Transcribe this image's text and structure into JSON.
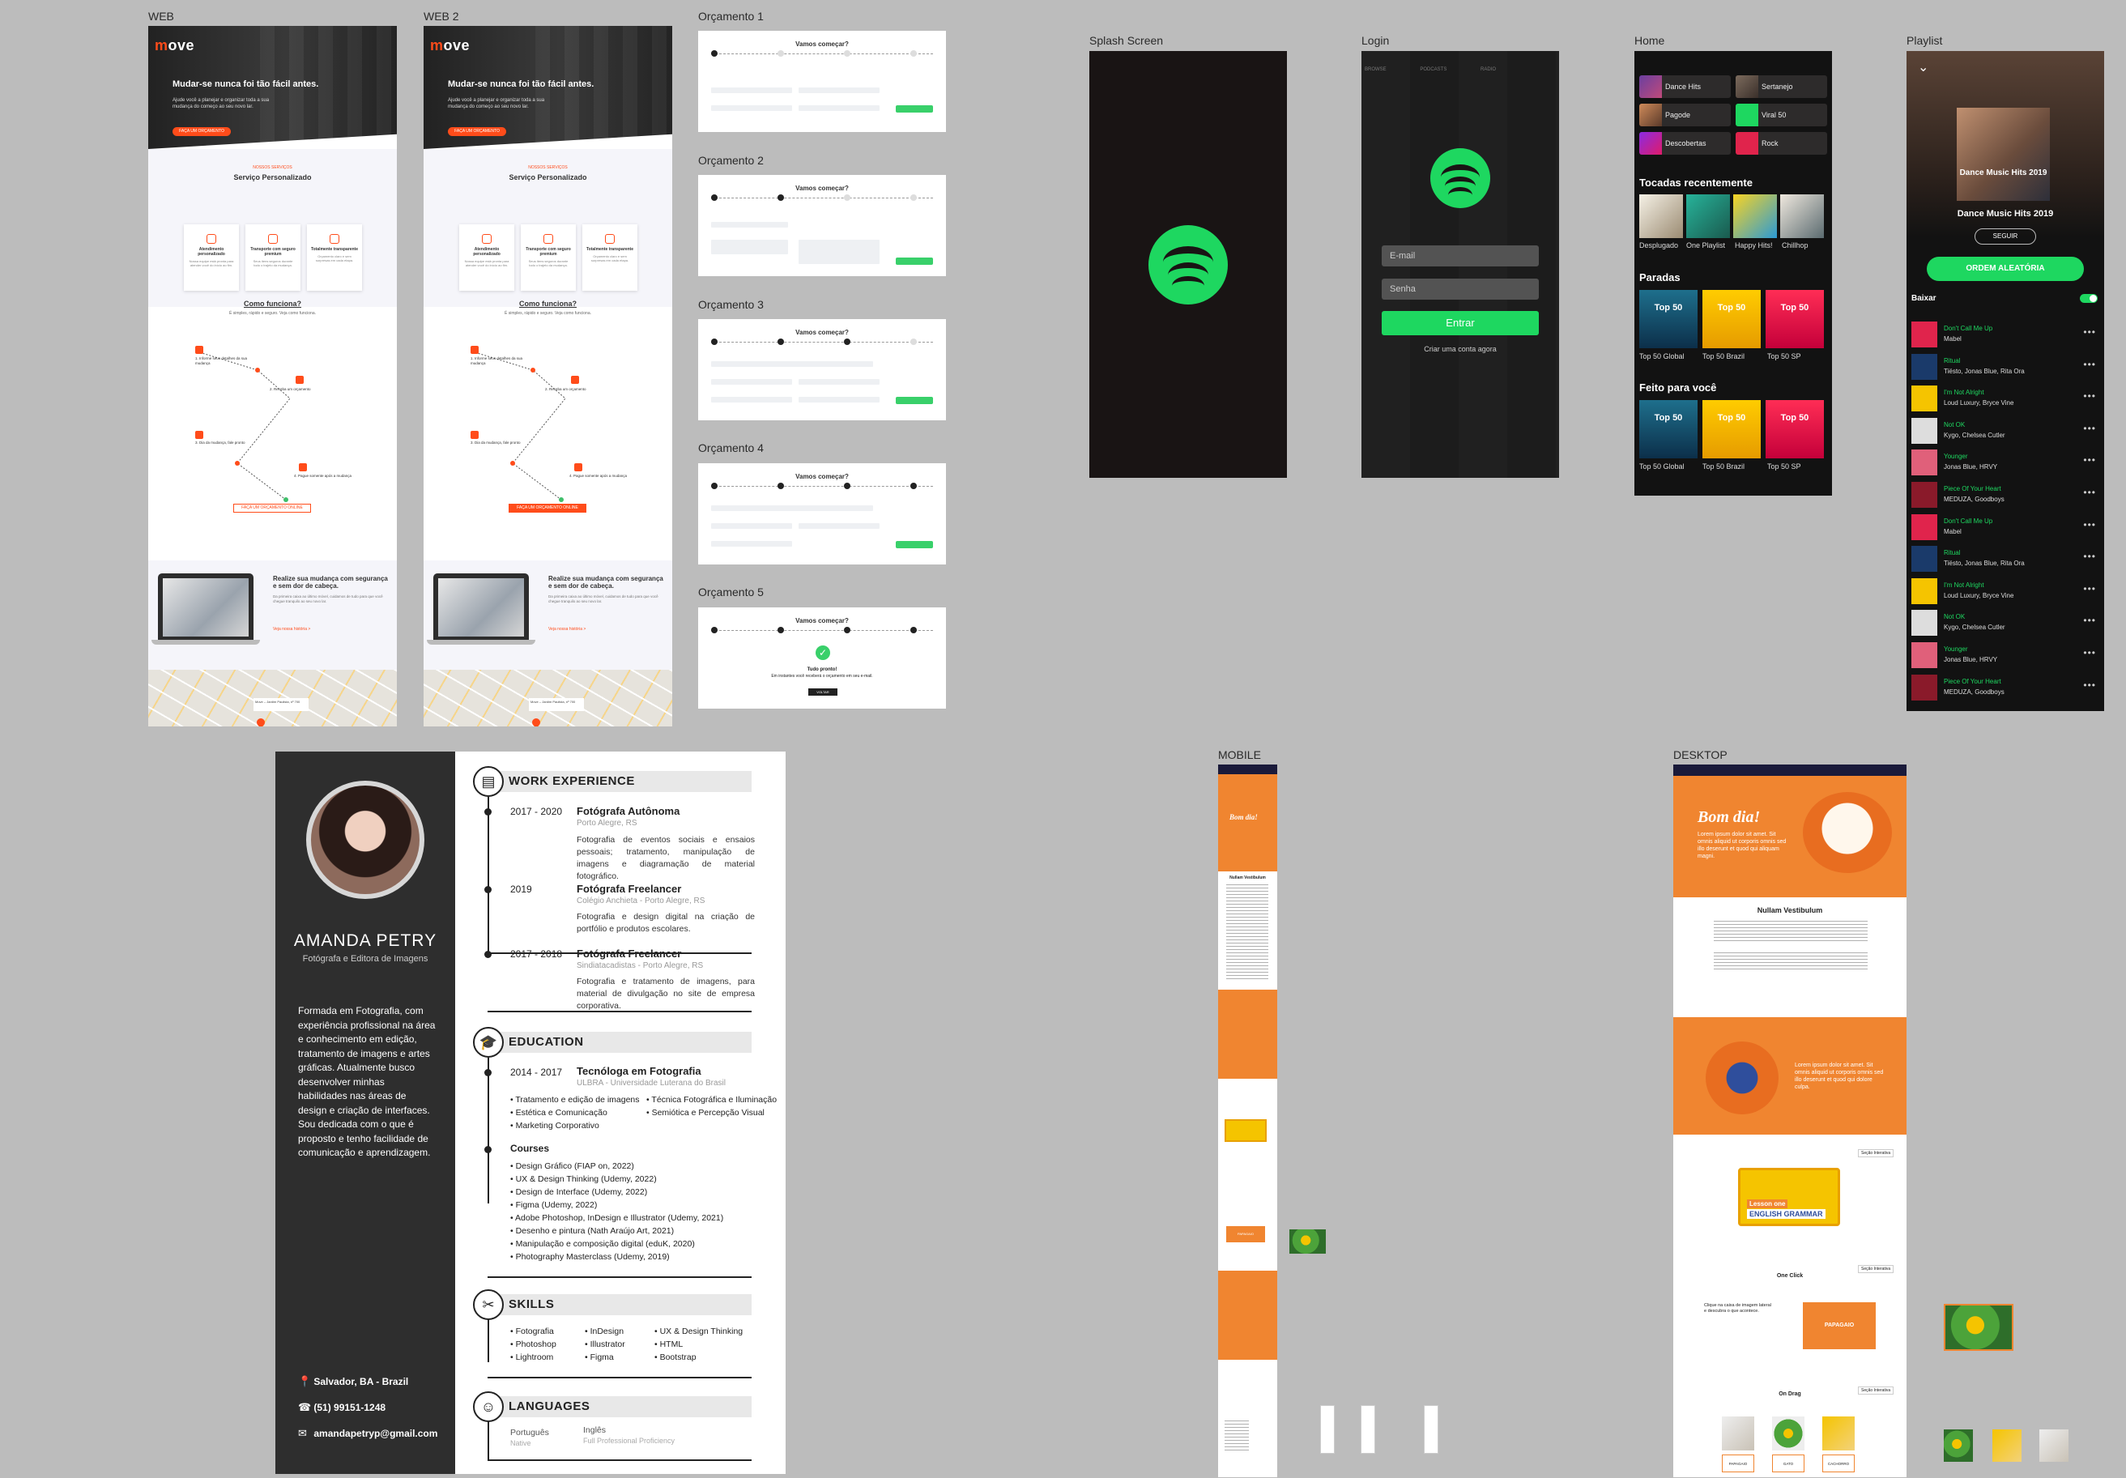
{
  "labels": {
    "web": "WEB",
    "web2": "WEB 2",
    "orc1": "Orçamento 1",
    "orc2": "Orçamento 2",
    "orc3": "Orçamento 3",
    "orc4": "Orçamento 4",
    "orc5": "Orçamento 5",
    "splash": "Splash Screen",
    "login": "Login",
    "home": "Home",
    "playlist": "Playlist",
    "mobile": "MOBILE",
    "desktop": "DESKTOP"
  },
  "move": {
    "logo_a": "m",
    "logo_o": "o",
    "logo_b": "ve",
    "headline": "Mudar-se nunca foi tão fácil antes.",
    "hero_sub": "Ajude você a planejar e organizar toda a sua mudança do começo ao seu novo lar.",
    "cta": "FAÇA UM ORÇAMENTO",
    "services_small": "NOSSOS SERVIÇOS",
    "services_title": "Serviço Personalizado",
    "cards": [
      {
        "title": "Atendimento personalizado",
        "desc": "Nossa equipe está pronta para atender você do início ao fim."
      },
      {
        "title": "Transporte com seguro premium",
        "desc": "Seus itens seguros durante todo o trajeto da mudança."
      },
      {
        "title": "Totalmente transparente",
        "desc": "Orçamento claro e sem surpresas em cada etapa."
      }
    ],
    "how_title": "Como funciona?",
    "how_sub": "É simples, rápido e seguro. Veja como funciona.",
    "steps": [
      "1. Informe seus detalhes da sua mudança",
      "2. Receba um orçamento",
      "3. Dia da mudança, fale pronto",
      "4. Pague somente após a mudança"
    ],
    "cta2": "FAÇA UM ORÇAMENTO ONLINE",
    "laptop_title": "Realize sua mudança com segurança e sem dor de cabeça.",
    "laptop_text": "Da primeira caixa ao último móvel, cuidamos de tudo para que você chegue tranquilo ao seu novo lar.",
    "link": "Veja nossa história  >",
    "map_card": "Move – Jardim Paulista, nº 700"
  },
  "orcamento": {
    "title": "Vamos começar?",
    "done_title": "Tudo pronto!",
    "done_text": "Em instantes você receberá o orçamento em seu e-mail.",
    "done_btn": "VOLTAR"
  },
  "spotify": {
    "login": {
      "email": "E-mail",
      "password": "Senha",
      "button": "Entrar",
      "create": "Criar uma conta agora",
      "tabs": [
        "BROWSE",
        "PODCASTS",
        "RADIO"
      ]
    },
    "home": {
      "tiles": [
        "Dance Hits",
        "Sertanejo",
        "Pagode",
        "Viral 50",
        "Descobertas",
        "Rock"
      ],
      "recent_title": "Tocadas recentemente",
      "recent": [
        "Desplugado",
        "One Playlist",
        "Happy Hits!",
        "Chillhop"
      ],
      "charts_title": "Paradas",
      "charts": [
        "Top 50 Global",
        "Top 50 Brazil",
        "Top 50 SP"
      ],
      "foryou_title": "Feito para você",
      "foryou": [
        "Top 50 Global",
        "Top 50 Brazil",
        "Top 50 SP"
      ],
      "top50": "Top 50"
    },
    "playlist": {
      "name": "Dance Music Hits 2019",
      "cover_text": "Dance Music Hits 2019",
      "follow": "SEGUIR",
      "shuffle": "ORDEM ALEATÓRIA",
      "download": "Baixar",
      "tracks": [
        {
          "title": "Don't Call Me Up",
          "artist": "Mabel"
        },
        {
          "title": "Ritual",
          "artist": "Tiësto, Jonas Blue, Rita Ora"
        },
        {
          "title": "I'm Not Alright",
          "artist": "Loud Luxury, Bryce Vine"
        },
        {
          "title": "Not OK",
          "artist": "Kygo, Chelsea Cutler"
        },
        {
          "title": "Younger",
          "artist": "Jonas Blue, HRVY"
        },
        {
          "title": "Piece Of Your Heart",
          "artist": "MEDUZA, Goodboys"
        },
        {
          "title": "Don't Call Me Up",
          "artist": "Mabel"
        },
        {
          "title": "Ritual",
          "artist": "Tiësto, Jonas Blue, Rita Ora"
        },
        {
          "title": "I'm Not Alright",
          "artist": "Loud Luxury, Bryce Vine"
        },
        {
          "title": "Not OK",
          "artist": "Kygo, Chelsea Cutler"
        },
        {
          "title": "Younger",
          "artist": "Jonas Blue, HRVY"
        },
        {
          "title": "Piece Of Your Heart",
          "artist": "MEDUZA, Goodboys"
        }
      ]
    }
  },
  "resume": {
    "name": "AMANDA PETRY",
    "role": "Fotógrafa e Editora de Imagens",
    "about": "Formada em Fotografia, com experiência profissional na área e conhecimento em edição, tratamento de imagens e artes gráficas. Atualmente busco desenvolver minhas habilidades nas áreas de design e criação de interfaces. Sou dedicada com o que é proposto e tenho facilidade de comunicação  e aprendizagem.",
    "location": "Salvador, BA - Brazil",
    "phone": "(51) 99151-1248",
    "email": "amandapetryp@gmail.com",
    "work_title": "WORK EXPERIENCE",
    "jobs": [
      {
        "date": "2017 - 2020",
        "title": "Fotógrafa Autônoma",
        "place": "Porto Alegre, RS",
        "desc": "Fotografia de eventos sociais e ensaios pessoais; tratamento, manipulação de imagens e diagramação de material fotográfico."
      },
      {
        "date": "2019",
        "title": "Fotógrafa Freelancer",
        "place": "Colégio Anchieta - Porto Alegre, RS",
        "desc": "Fotografia e design digital na criação de portfólio e produtos escolares."
      },
      {
        "date": "2017 - 2018",
        "title": "Fotógrafa Freelancer",
        "place": "Sindiatacadistas - Porto Alegre, RS",
        "desc": "Fotografia e tratamento de imagens, para material de divulgação no site de empresa corporativa."
      }
    ],
    "edu_title": "EDUCATION",
    "edu": {
      "date": "2014 - 2017",
      "title": "Tecnóloga em Fotografia",
      "place": "ULBRA - Universidade Luterana do Brasil",
      "col1": [
        "• Tratamento e edição de imagens",
        "• Estética e Comunicação",
        "• Marketing Corporativo"
      ],
      "col2": [
        "• Técnica Fotográfica e Iluminação",
        "• Semiótica e Percepção Visual"
      ]
    },
    "courses_title": "Courses",
    "courses": [
      "• Design Gráfico  (FIAP on, 2022)",
      "• UX & Design Thinking  (Udemy, 2022)",
      "• Design de Interface  (Udemy, 2022)",
      "• Figma  (Udemy, 2022)",
      "• Adobe Photoshop, InDesign e Illustrator  (Udemy, 2021)",
      "• Desenho e pintura  (Nath Araújo Art, 2021)",
      "• Manipulação e composição digital  (eduK, 2020)",
      "• Photography Masterclass  (Udemy, 2019)"
    ],
    "skills_title": "SKILLS",
    "skills": [
      [
        "• Fotografia",
        "• Photoshop",
        "• Lightroom"
      ],
      [
        "• InDesign",
        "• Illustrator",
        "• Figma"
      ],
      [
        "• UX & Design Thinking",
        "• HTML",
        "• Bootstrap"
      ]
    ],
    "lang_title": "LANGUAGES",
    "langs": [
      {
        "name": "Português",
        "level": "Native"
      },
      {
        "name": "Inglês",
        "level": "Full Professional Proficiency"
      }
    ]
  },
  "learning": {
    "greeting": "Bom dia!",
    "hero_text": "Lorem ipsum dolor sit amet. Sit omnis aliquid ut corporis omnis sed illo deserunt et quod qui aliquam magni.",
    "section1": "Nullam Vestibulum",
    "mid_text": "Lorem ipsum dolor sit amet. Sit omnis aliquid ut corporis omnis sed illo deserunt et quod qui dolore culpa.",
    "lesson_line1": "Lesson one",
    "lesson_line2": "ENGLISH GRAMMAR",
    "one_click": "One Click",
    "one_click_text": "Clique na caixa de imagem lateral e descubra o que acontece.",
    "button": "PAPAGAIO",
    "on_drag": "On Drag",
    "drag_labels": [
      "PAPAGAIO",
      "GATO",
      "CACHORRO"
    ],
    "badge": "Seção Interativa"
  },
  "colors": {
    "move_orange": "#ff4c1a",
    "spotify_green": "#1ed760",
    "learning_orange": "#f08530"
  }
}
